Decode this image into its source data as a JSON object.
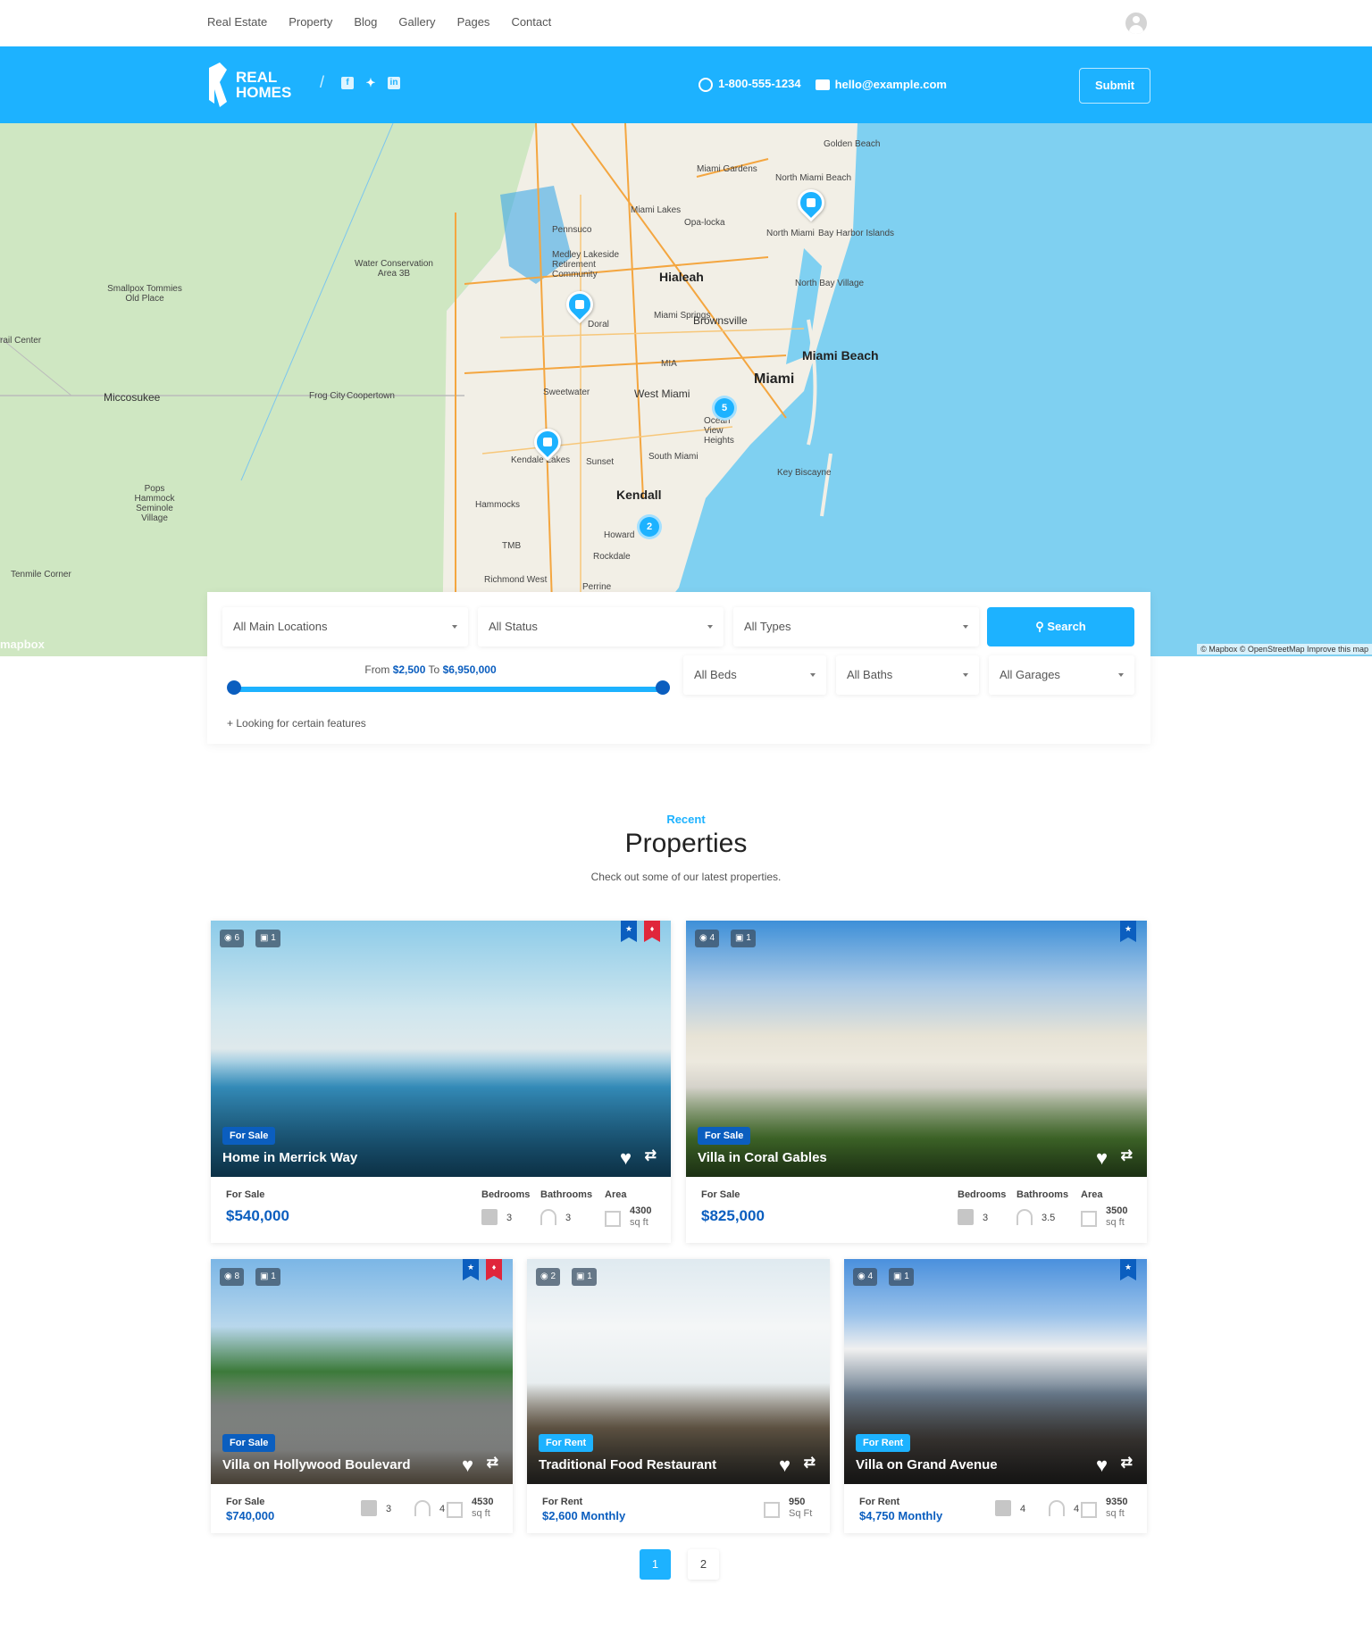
{
  "topnav": {
    "items": [
      "Real Estate",
      "Property",
      "Blog",
      "Gallery",
      "Pages",
      "Contact"
    ]
  },
  "header": {
    "logo": "REAL HOMES",
    "logo_line1": "REAL",
    "logo_line2": "HOMES",
    "phone": "1-800-555-1234",
    "email": "hello@example.com",
    "submit": "Submit",
    "accent": "#1db2ff"
  },
  "map": {
    "labels": [
      "Golden Beach",
      "Miami Gardens",
      "North Miami Beach",
      "Opa-locka",
      "Miami Lakes",
      "North Miami",
      "Bay Harbor Islands",
      "Pennsuco",
      "Medley Lakeside Retirement Community",
      "Water Conservation Area 3B",
      "Hialeah",
      "North Bay Village",
      "Smallpox Tommies Old Place",
      "Doral",
      "Miami Springs",
      "Brownsville",
      "Miami Beach",
      "Miami",
      "MIA",
      "Sweetwater",
      "West Miami",
      "Miccosukee",
      "Frog City",
      "Coopertown",
      "rail Center",
      "Ocean View Heights",
      "Kendale Lakes",
      "Sunset",
      "South Miami",
      "Key Biscayne",
      "Pops Hammock Seminole Village",
      "Kendall",
      "Hammocks",
      "TMB",
      "Howard",
      "Rockdale",
      "Tenmile Corner",
      "Richmond West",
      "Perrine"
    ],
    "clusters": [
      "5",
      "2"
    ],
    "attribution": "© Mapbox © OpenStreetMap Improve this map",
    "brand": "mapbox"
  },
  "search": {
    "location": "All Main Locations",
    "status": "All Status",
    "types": "All Types",
    "button": "Search",
    "price_from_label": "From",
    "price_from": "$2,500",
    "price_to_label": "To",
    "price_to": "$6,950,000",
    "beds": "All Beds",
    "baths": "All Baths",
    "garages": "All Garages",
    "features": "+ Looking for certain features"
  },
  "section": {
    "eyebrow": "Recent",
    "title": "Properties",
    "subtitle": "Check out some of our latest properties."
  },
  "labels": {
    "bedrooms": "Bedrooms",
    "bathrooms": "Bathrooms",
    "area": "Area"
  },
  "properties": [
    {
      "title": "Home in Merrick Way",
      "badge": "For Sale",
      "status": "For Sale",
      "price": "$540,000",
      "photos": "6",
      "videos": "1",
      "beds": "3",
      "baths": "3",
      "area": "4300",
      "area_unit": "sq ft",
      "featured": true,
      "hot": true
    },
    {
      "title": "Villa in Coral Gables",
      "badge": "For Sale",
      "status": "For Sale",
      "price": "$825,000",
      "photos": "4",
      "videos": "1",
      "beds": "3",
      "baths": "3.5",
      "area": "3500",
      "area_unit": "sq ft",
      "featured": true,
      "hot": false
    },
    {
      "title": "Villa on Hollywood Boulevard",
      "badge": "For Sale",
      "status": "For Sale",
      "price": "$740,000",
      "photos": "8",
      "videos": "1",
      "beds": "3",
      "baths": "4",
      "area": "4530",
      "area_unit": "sq ft",
      "featured": true,
      "hot": true
    },
    {
      "title": "Traditional Food Restaurant",
      "badge": "For Rent",
      "status": "For Rent",
      "price": "$2,600 Monthly",
      "photos": "2",
      "videos": "1",
      "area": "950",
      "area_unit": "Sq Ft",
      "featured": false,
      "hot": false
    },
    {
      "title": "Villa on Grand Avenue",
      "badge": "For Rent",
      "status": "For Rent",
      "price": "$4,750 Monthly",
      "photos": "4",
      "videos": "1",
      "beds": "4",
      "baths": "4",
      "area": "9350",
      "area_unit": "sq ft",
      "featured": true,
      "hot": false
    }
  ],
  "pagination": {
    "pages": [
      "1",
      "2"
    ],
    "current": "1"
  }
}
